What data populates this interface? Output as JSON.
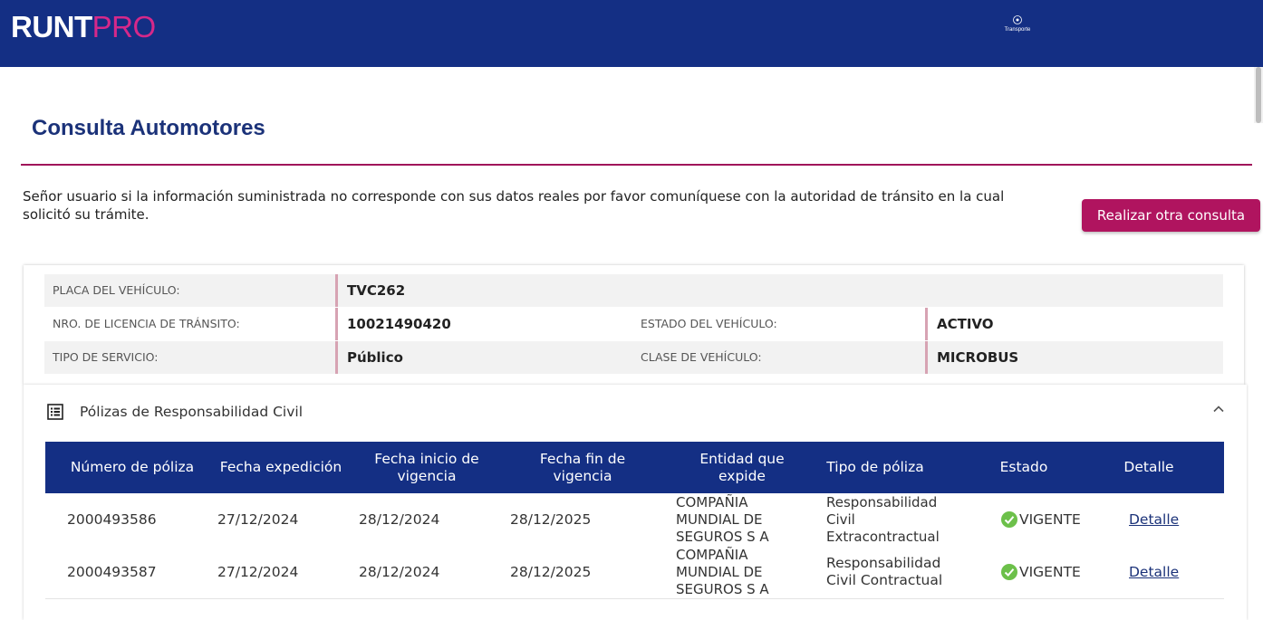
{
  "header": {
    "logo_part1": "RUNT",
    "logo_part2": "PRO",
    "agency_label": "Transporte"
  },
  "page": {
    "title": "Consulta Automotores",
    "notice": "Señor usuario si la información suministrada no corresponde con sus datos reales por favor comuníquese con la autoridad de tránsito en la cual solicitó su trámite.",
    "new_query_button": "Realizar otra consulta"
  },
  "vehicle": {
    "plate_label": "PLACA DEL VEHÍCULO:",
    "plate": "TVC262",
    "license_label": "NRO. DE LICENCIA DE TRÁNSITO:",
    "license": "10021490420",
    "status_label": "ESTADO DEL VEHÍCULO:",
    "status": "ACTIVO",
    "service_label": "TIPO DE SERVICIO:",
    "service": "Público",
    "class_label": "CLASE DE VEHÍCULO:",
    "class": "MICROBUS"
  },
  "policies": {
    "section_title": "Pólizas de Responsabilidad Civil",
    "columns": [
      "Número de póliza",
      "Fecha expedición",
      "Fecha inicio de vigencia",
      "Fecha fin de vigencia",
      "Entidad que expide",
      "Tipo de póliza",
      "Estado",
      "Detalle"
    ],
    "rows": [
      {
        "number": "2000493586",
        "issued": "27/12/2024",
        "start": "28/12/2024",
        "end": "28/12/2025",
        "entity": "COMPAÑIA MUNDIAL DE SEGUROS S A",
        "type": "Responsabilidad Civil Extracontractual",
        "status": "VIGENTE",
        "detail": "Detalle"
      },
      {
        "number": "2000493587",
        "issued": "27/12/2024",
        "start": "28/12/2024",
        "end": "28/12/2025",
        "entity": "COMPAÑIA MUNDIAL DE SEGUROS S A",
        "type": "Responsabilidad Civil Contractual",
        "status": "VIGENTE",
        "detail": "Detalle"
      }
    ]
  },
  "colors": {
    "brand_blue": "#142f84",
    "accent_magenta": "#b0145f",
    "status_green": "#6cc04a"
  },
  "icons": {
    "section": "list-icon",
    "collapse": "chevron-up-icon",
    "status": "check-circle-icon"
  }
}
